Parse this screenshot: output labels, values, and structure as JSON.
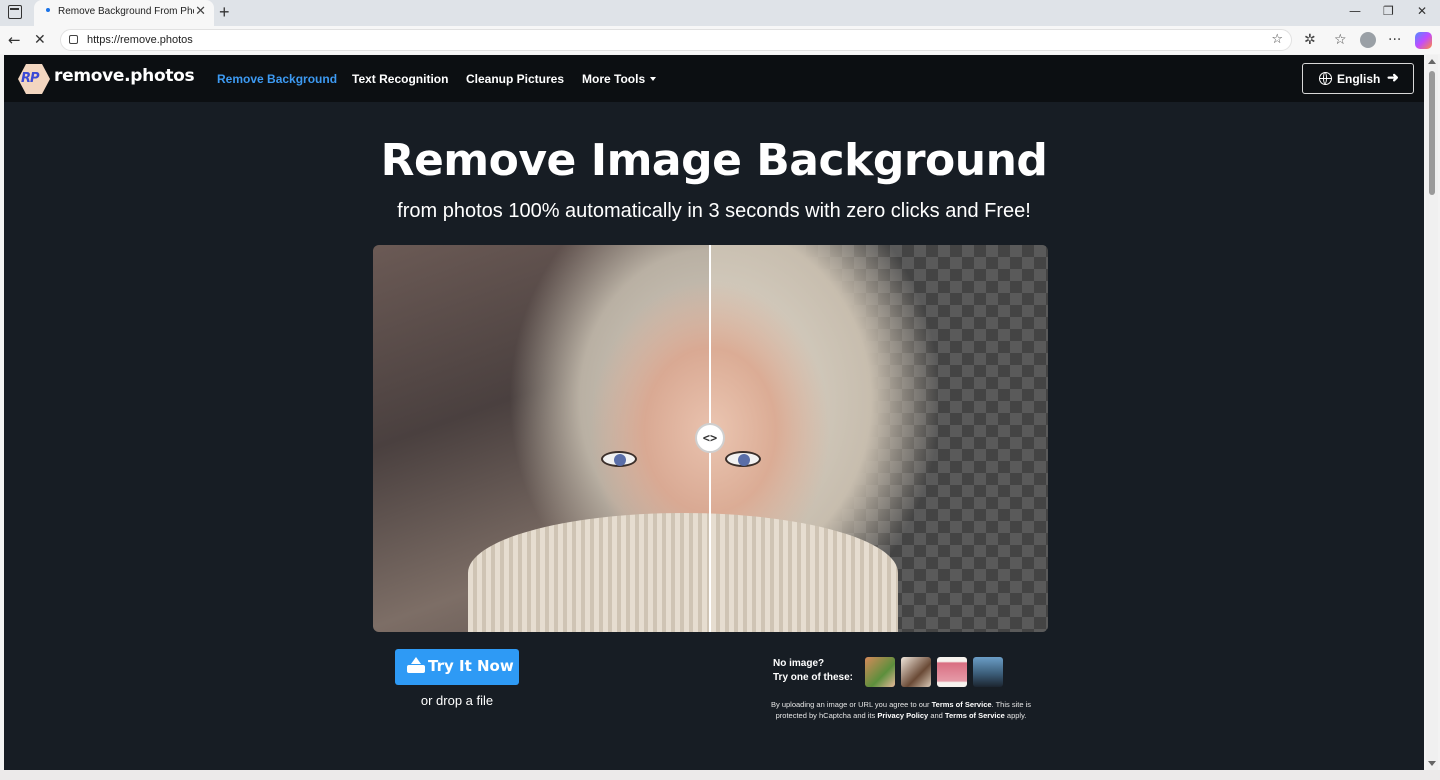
{
  "browser": {
    "tab_title": "Remove Background From Photos",
    "tab_close": "✕",
    "new_tab": "+",
    "url": "https://remove.photos",
    "window_controls": {
      "minimize": "—",
      "restore": "❐",
      "close": "✕"
    },
    "menu_dots": "···"
  },
  "site": {
    "brand": "remove.photos",
    "logo_letters": "RP",
    "nav": {
      "remove_background": "Remove Background",
      "text_recognition": "Text Recognition",
      "cleanup_pictures": "Cleanup Pictures",
      "more_tools": "More Tools"
    },
    "language": "English"
  },
  "hero": {
    "title": "Remove Image Background",
    "subtitle": "from photos 100% automatically in 3 seconds with zero clicks and Free!",
    "handle_glyph": "<>"
  },
  "cta": {
    "try_label": "Try It Now",
    "drop_text": "or drop a file",
    "no_image_line1": "No image?",
    "no_image_line2": "Try one of these:"
  },
  "terms": {
    "p1": "By uploading an image or URL you agree to our ",
    "tos1": "Terms of Service",
    "p2": ". This site is protected by hCaptcha and its ",
    "privacy": "Privacy Policy",
    "p3": " and ",
    "tos2": "Terms of Service",
    "p4": " apply."
  },
  "colors": {
    "accent": "#2e9af5",
    "nav_active": "#3d9af2",
    "page_bg": "#171d24",
    "header_bg": "#0c0f12"
  }
}
